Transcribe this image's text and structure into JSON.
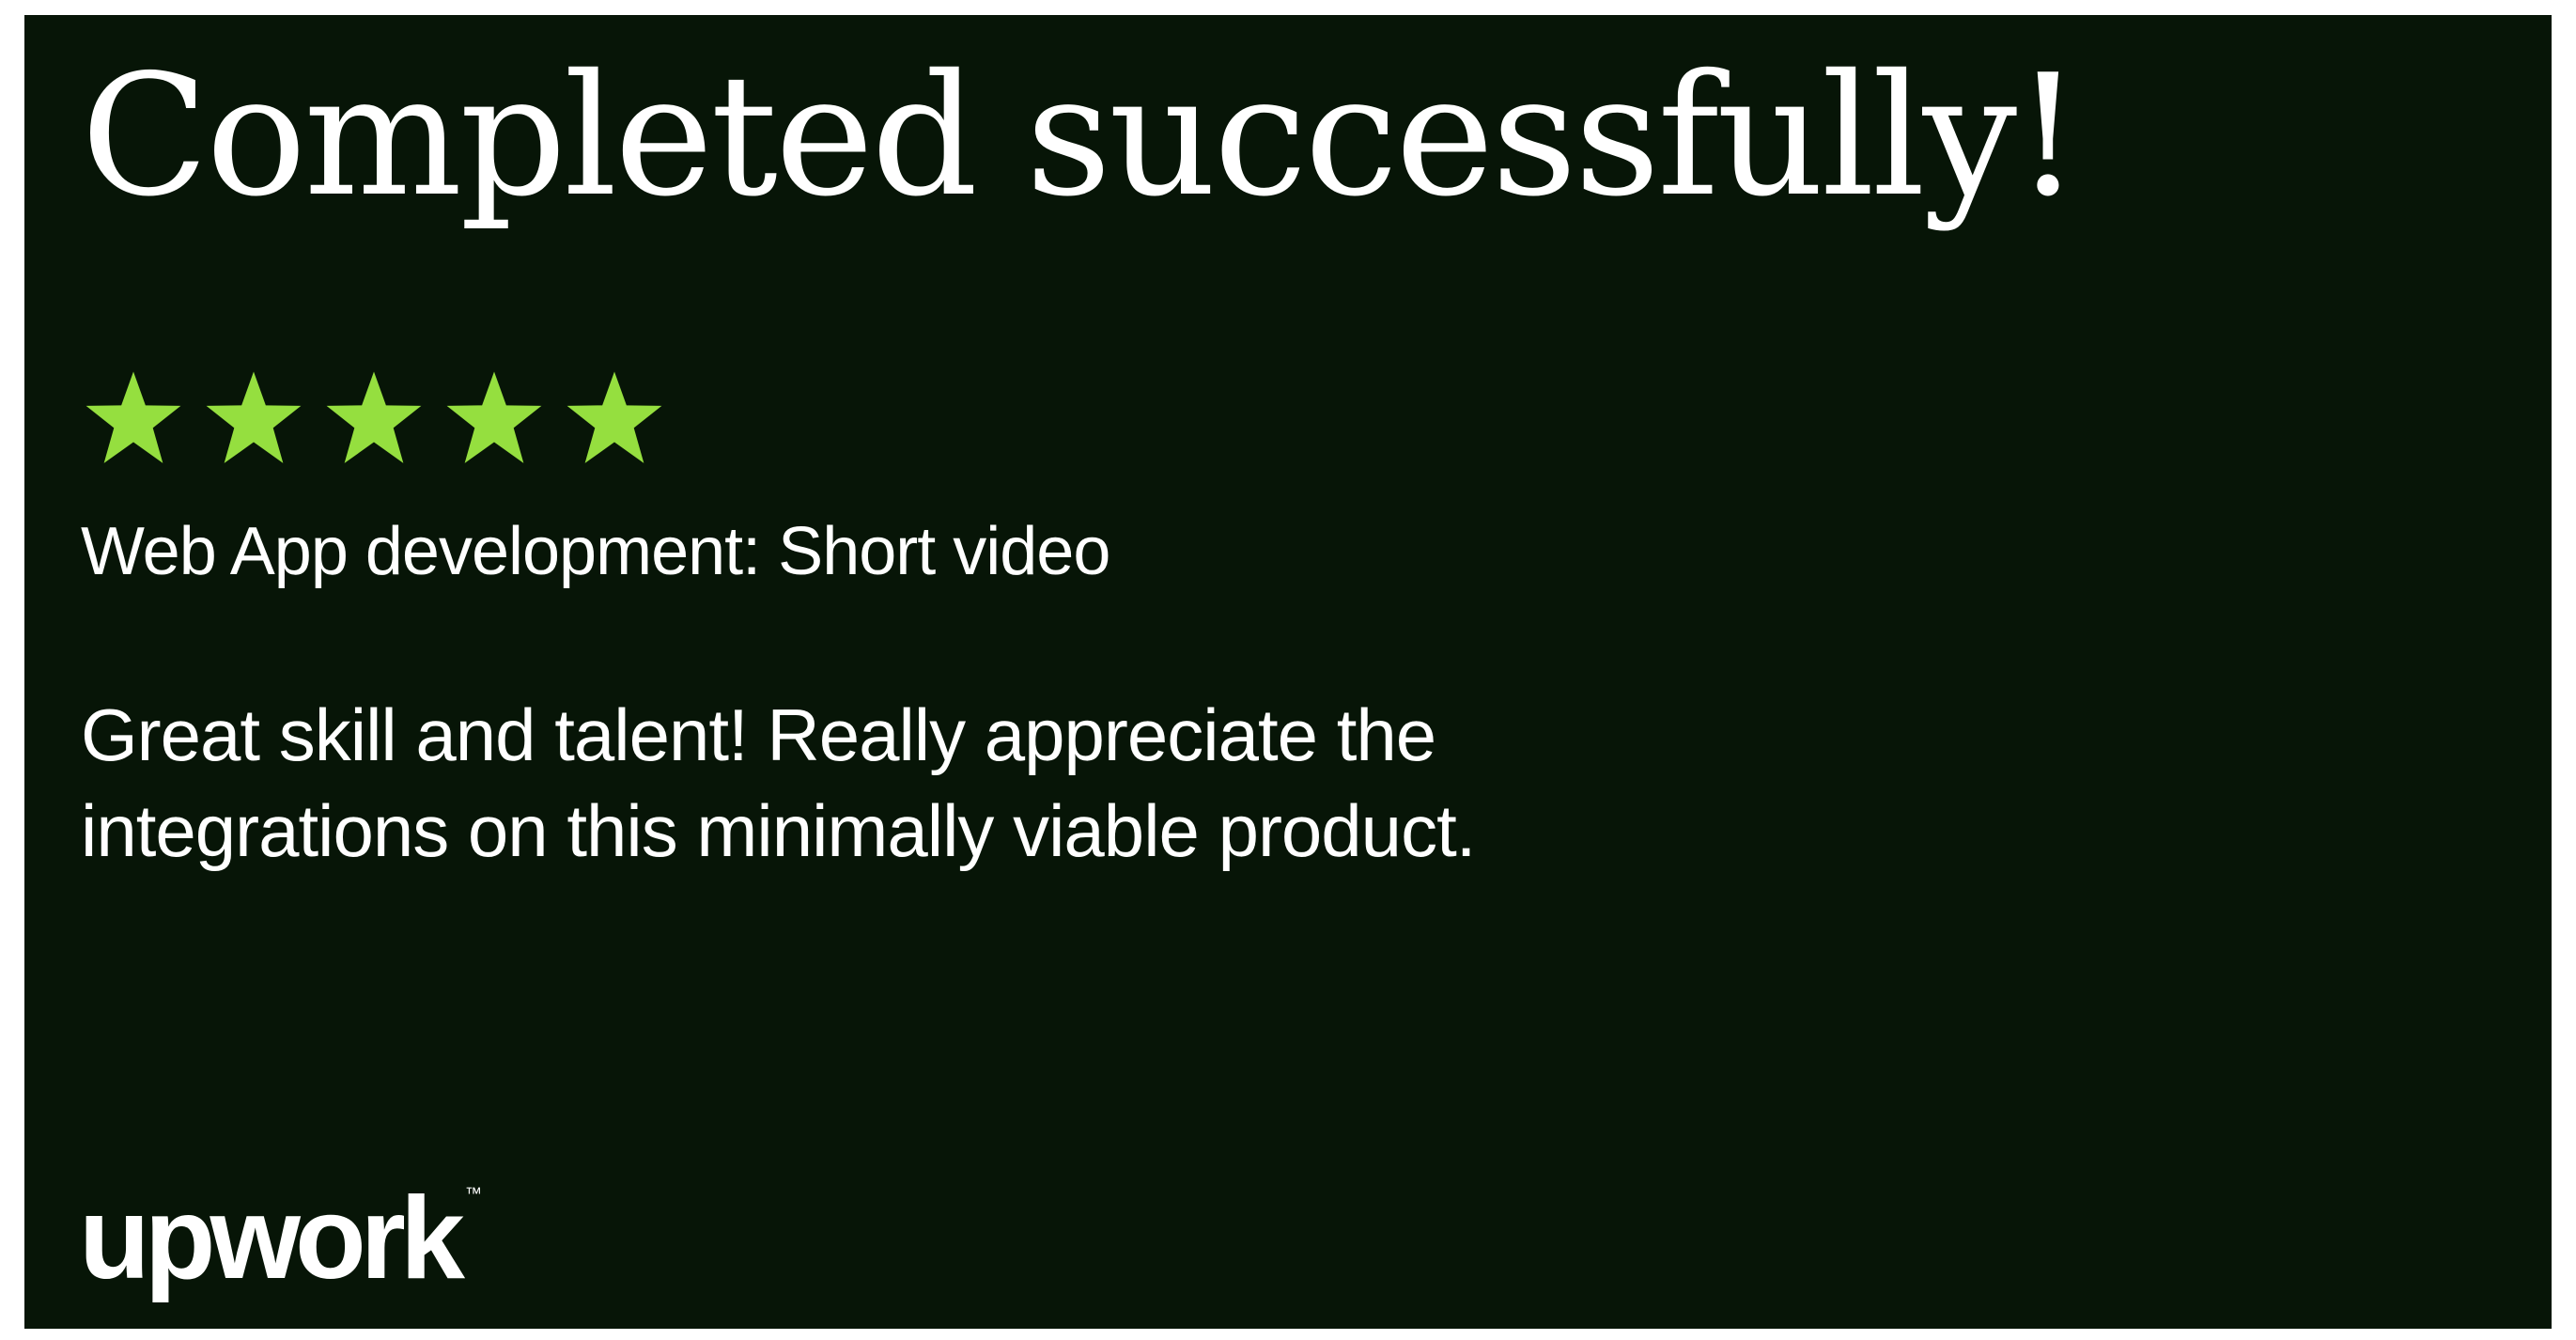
{
  "card": {
    "title": "Completed successfully!",
    "rating": {
      "value": 5,
      "max": 5,
      "icon": "star-icon",
      "color": "#95df3f"
    },
    "project": "Web App development: Short video",
    "review": "Great skill and talent! Really appreciate the integrations on this minimally viable product.",
    "logo": {
      "text": "upwork",
      "trademark": "™"
    },
    "colors": {
      "background": "#071507",
      "text": "#ffffff",
      "accent": "#95df3f"
    }
  }
}
